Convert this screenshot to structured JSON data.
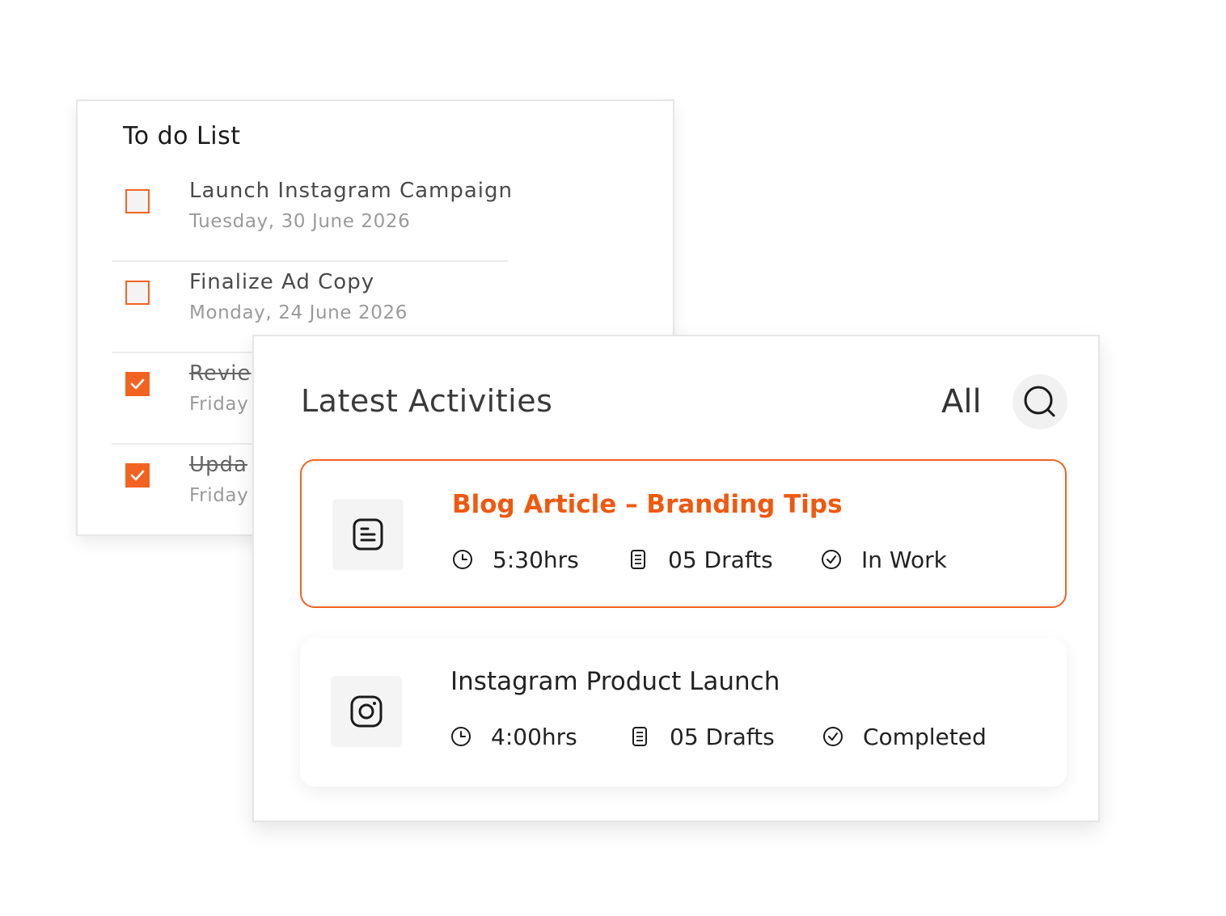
{
  "todo": {
    "title": "To do List",
    "items": [
      {
        "label": "Launch Instagram Campaign",
        "date": "Tuesday, 30 June 2026",
        "checked": false
      },
      {
        "label": "Finalize Ad Copy",
        "date": "Monday, 24 June 2026",
        "checked": false
      },
      {
        "label": "Revie",
        "date": "Friday",
        "checked": true
      },
      {
        "label": "Upda",
        "date": "Friday",
        "checked": true
      }
    ]
  },
  "activities": {
    "title": "Latest Activities",
    "filter": "All",
    "items": [
      {
        "title": "Blog Article – Branding Tips",
        "icon": "document-icon",
        "time": "5:30hrs",
        "drafts": "05 Drafts",
        "status": "In Work"
      },
      {
        "title": "Instagram Product Launch",
        "icon": "instagram-icon",
        "time": "4:00hrs",
        "drafts": "05 Drafts",
        "status": "Completed"
      }
    ]
  },
  "colors": {
    "accent": "#f26322",
    "highlight_text": "#f0580f"
  }
}
